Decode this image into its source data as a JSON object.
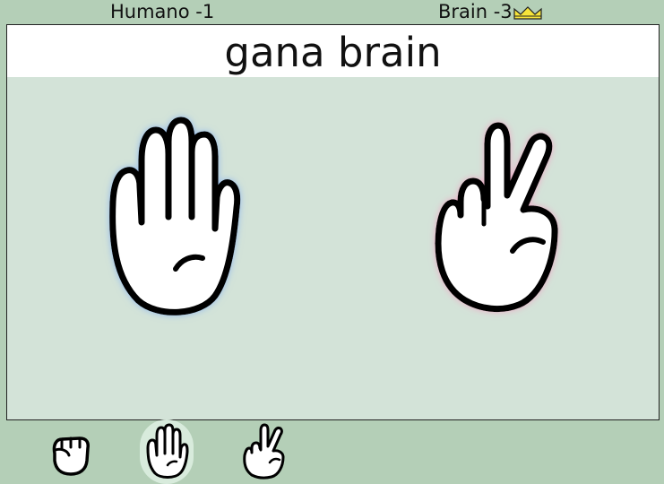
{
  "scores": {
    "human_label": "Humano -1",
    "brain_label": "Brain -3",
    "winner_icon": "crown-icon"
  },
  "result_text": "gana brain",
  "human_hand": "paper-hand-icon",
  "brain_hand": "scissors-hand-icon",
  "choices": [
    {
      "name": "rock",
      "icon": "rock-hand-icon",
      "selected": false
    },
    {
      "name": "paper",
      "icon": "paper-hand-icon",
      "selected": true
    },
    {
      "name": "scissors",
      "icon": "scissors-hand-icon",
      "selected": false
    }
  ],
  "colors": {
    "background": "#b4cfb7",
    "board": "#d3e3d8",
    "human_glow": "#8fb6ef",
    "brain_glow": "#f0a6c6",
    "crown": "#f6e43a"
  }
}
